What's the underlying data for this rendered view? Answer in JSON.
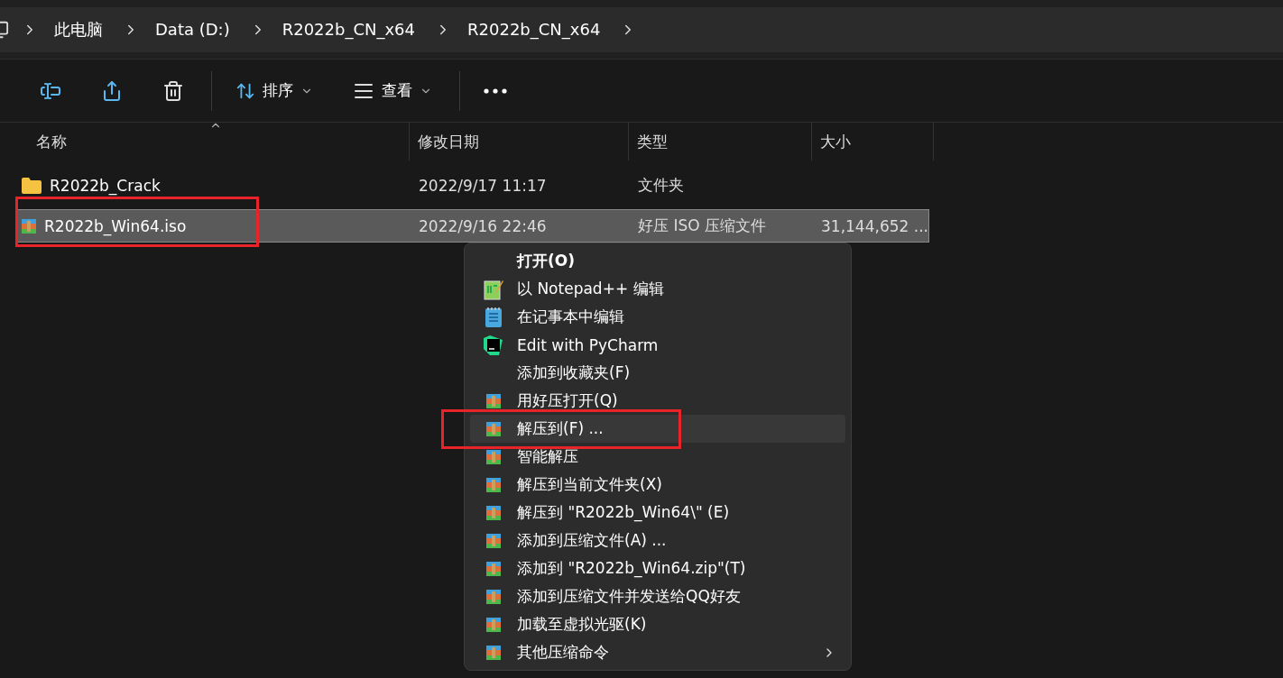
{
  "breadcrumb": [
    {
      "label": "此电脑"
    },
    {
      "label": "Data (D:)"
    },
    {
      "label": "R2022b_CN_x64"
    },
    {
      "label": "R2022b_CN_x64"
    }
  ],
  "toolbar": {
    "sort": "排序",
    "view": "查看"
  },
  "columns": [
    {
      "label": "名称",
      "sorted": true
    },
    {
      "label": "修改日期",
      "sorted": false
    },
    {
      "label": "类型",
      "sorted": false
    },
    {
      "label": "大小",
      "sorted": false
    }
  ],
  "files": [
    {
      "kind": "folder",
      "name": "R2022b_Crack",
      "date": "2022/9/17 11:17",
      "type": "文件夹",
      "selected": false,
      "annotated": false
    },
    {
      "kind": "archive",
      "name": "R2022b_Win64.iso",
      "date": "2022/9/16 22:46",
      "type": "好压 ISO 压缩文件",
      "size": "31,144,652 ...",
      "selected": true,
      "annotated": true
    }
  ],
  "context_menu": {
    "items": [
      {
        "kind": "plain",
        "label": "打开(O)",
        "default": true,
        "highlighted": false,
        "annotated": false,
        "submenu": false
      },
      {
        "kind": "notepadpp",
        "label": "以 Notepad++ 编辑",
        "default": false,
        "highlighted": false,
        "annotated": false,
        "submenu": false
      },
      {
        "kind": "notepad",
        "label": "在记事本中编辑",
        "default": false,
        "highlighted": false,
        "annotated": false,
        "submenu": false
      },
      {
        "kind": "pycharm",
        "label": "Edit with PyCharm",
        "default": false,
        "highlighted": false,
        "annotated": false,
        "submenu": false
      },
      {
        "kind": "plain",
        "label": "添加到收藏夹(F)",
        "default": false,
        "highlighted": false,
        "annotated": false,
        "submenu": false
      },
      {
        "kind": "archive",
        "label": "用好压打开(Q)",
        "default": false,
        "highlighted": false,
        "annotated": false,
        "submenu": false
      },
      {
        "kind": "archive",
        "label": "解压到(F) ...",
        "default": false,
        "highlighted": true,
        "annotated": true,
        "submenu": false
      },
      {
        "kind": "archive",
        "label": "智能解压",
        "default": false,
        "highlighted": false,
        "annotated": false,
        "submenu": false
      },
      {
        "kind": "archive",
        "label": "解压到当前文件夹(X)",
        "default": false,
        "highlighted": false,
        "annotated": false,
        "submenu": false
      },
      {
        "kind": "archive",
        "label": "解压到 \"R2022b_Win64\\\" (E)",
        "default": false,
        "highlighted": false,
        "annotated": false,
        "submenu": false
      },
      {
        "kind": "archive",
        "label": "添加到压缩文件(A) ...",
        "default": false,
        "highlighted": false,
        "annotated": false,
        "submenu": false
      },
      {
        "kind": "archive",
        "label": "添加到 \"R2022b_Win64.zip\"(T)",
        "default": false,
        "highlighted": false,
        "annotated": false,
        "submenu": false
      },
      {
        "kind": "archive",
        "label": "添加到压缩文件并发送给QQ好友",
        "default": false,
        "highlighted": false,
        "annotated": false,
        "submenu": false
      },
      {
        "kind": "archive",
        "label": "加载至虚拟光驱(K)",
        "default": false,
        "highlighted": false,
        "annotated": false,
        "submenu": false
      },
      {
        "kind": "archive",
        "label": "其他压缩命令",
        "default": false,
        "highlighted": false,
        "annotated": false,
        "submenu": true
      }
    ]
  }
}
